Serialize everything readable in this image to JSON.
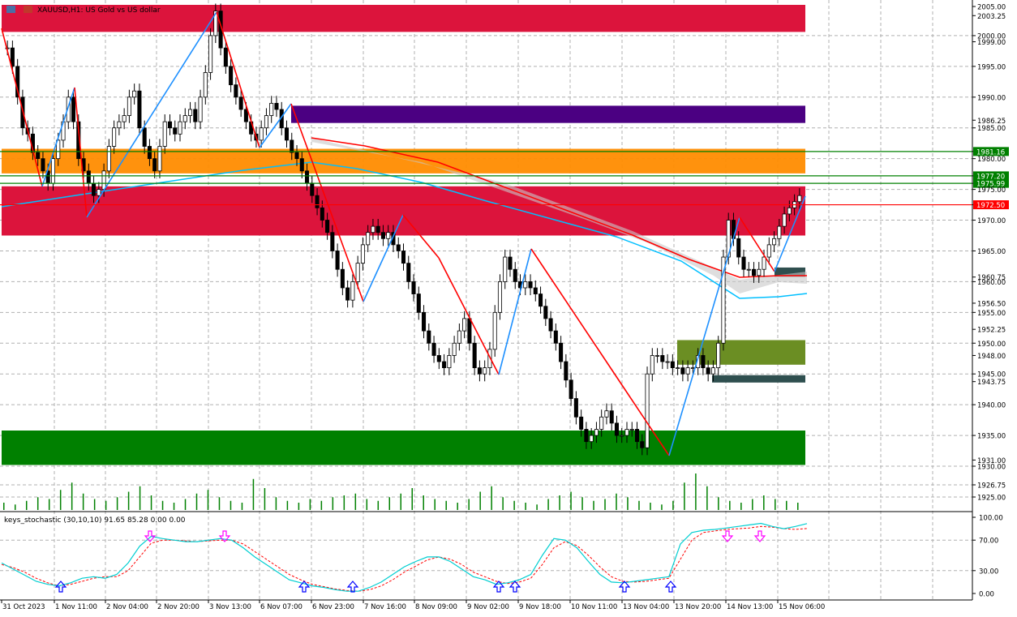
{
  "header": {
    "symbol": "XAUUSD",
    "timeframe": "H1",
    "description": "US Gold vs US dollar",
    "title": "XAUUSD,H1: US Gold vs US dollar"
  },
  "indicator": {
    "label": "keys_stochastic (30,10,10) 91.65 85.28 0.00 0.00",
    "levels": [
      "100.00",
      "70.00",
      "30.00",
      "0.00"
    ]
  },
  "colors": {
    "bull_candle": "#000000",
    "bear_candle": "#000000",
    "supply_zone": "#dc143c",
    "demand_zone": "#008000",
    "purple_zone": "#4b0082",
    "orange_zone": "#ff8c00",
    "olive_zone": "#6b8e23",
    "slate_zone": "#2f4f4f",
    "zigzag_up": "#1e90ff",
    "zigzag_down": "#ff0000",
    "ma_fast": "#00bfff",
    "ma_slow": "#ff0000",
    "stoch_main": "#00ced1",
    "stoch_signal": "#ff0000",
    "volume": "#008000",
    "arrow_up": "#0000ff",
    "arrow_down": "#ff00ff"
  },
  "chart_data": {
    "type": "candlestick",
    "symbol": "XAUUSD",
    "timeframe": "H1",
    "ylim": [
      1925.0,
      2005.0
    ],
    "current_price_label": "1972.50",
    "price_axis_labels": [
      "2005.00",
      "2003.25",
      "2000.00",
      "1999.00",
      "1995.00",
      "1990.00",
      "1986.25",
      "1985.00",
      "1981.16",
      "1980.00",
      "1977.20",
      "1975.99",
      "1975.00",
      "1972.50",
      "1970.00",
      "1965.00",
      "1960.75",
      "1960.00",
      "1956.50",
      "1955.00",
      "1952.25",
      "1950.00",
      "1948.00",
      "1945.00",
      "1943.75",
      "1940.00",
      "1935.00",
      "1931.00",
      "1930.00",
      "1926.75",
      "1925.00"
    ],
    "tagged_levels": [
      {
        "label": "1981.16",
        "value": 1981.16,
        "color": "#008000"
      },
      {
        "label": "1977.20",
        "value": 1977.2,
        "color": "#008000"
      },
      {
        "label": "1975.99",
        "value": 1975.99,
        "color": "#008000"
      },
      {
        "label": "1972.50",
        "value": 1972.5,
        "color": "#ff0000"
      }
    ],
    "zones": [
      {
        "name": "supply-top",
        "from": 2000.6,
        "to": 2005.0,
        "color": "#dc143c"
      },
      {
        "name": "supply-purple",
        "from": 1985.8,
        "to": 1988.6,
        "color": "#4b0082"
      },
      {
        "name": "supply-orange",
        "from": 1977.6,
        "to": 1981.6,
        "color": "#ff8c00"
      },
      {
        "name": "supply-main",
        "from": 1967.5,
        "to": 1975.5,
        "color": "#dc143c"
      },
      {
        "name": "demand-slate-1",
        "from": 1960.8,
        "to": 1962.3,
        "color": "#2f4f4f"
      },
      {
        "name": "demand-olive",
        "from": 1946.5,
        "to": 1950.5,
        "color": "#6b8e23"
      },
      {
        "name": "demand-slate-2",
        "from": 1943.6,
        "to": 1944.8,
        "color": "#2f4f4f"
      },
      {
        "name": "demand-bottom",
        "from": 1930.2,
        "to": 1935.8,
        "color": "#008000"
      }
    ],
    "time_labels": [
      "31 Oct 2023",
      "1 Nov 11:00",
      "2 Nov 04:00",
      "2 Nov 20:00",
      "3 Nov 13:00",
      "6 Nov 07:00",
      "6 Nov 23:00",
      "7 Nov 16:00",
      "8 Nov 09:00",
      "9 Nov 02:00",
      "9 Nov 18:00",
      "10 Nov 11:00",
      "13 Nov 04:00",
      "13 Nov 20:00",
      "14 Nov 13:00",
      "15 Nov 06:00"
    ],
    "close_series": [
      1998,
      1995,
      1990,
      1985,
      1984,
      1981,
      1980,
      1978,
      1976,
      1980,
      1983,
      1986,
      1990,
      1986,
      1980,
      1978,
      1976,
      1974,
      1975,
      1978,
      1982,
      1985,
      1986,
      1987,
      1990,
      1991,
      1985,
      1982,
      1980,
      1978,
      1982,
      1986,
      1985,
      1984,
      1986,
      1987,
      1988,
      1986,
      1990,
      1994,
      2000,
      2004,
      1998,
      1995,
      1992,
      1990,
      1988,
      1986,
      1984,
      1983,
      1985,
      1987,
      1989,
      1988,
      1985,
      1983,
      1981,
      1980,
      1978,
      1976,
      1974,
      1972,
      1970,
      1968,
      1965,
      1962,
      1959,
      1957,
      1960,
      1963,
      1966,
      1968,
      1969,
      1968,
      1967,
      1968,
      1966,
      1965,
      1963,
      1960,
      1958,
      1955,
      1952,
      1950,
      1948,
      1947,
      1946,
      1948,
      1950,
      1952,
      1954,
      1950,
      1946,
      1945,
      1946,
      1949,
      1955,
      1960,
      1964,
      1962,
      1960,
      1959,
      1960,
      1959,
      1958,
      1956,
      1954,
      1952,
      1950,
      1947,
      1944,
      1941,
      1938,
      1936,
      1934,
      1935,
      1936,
      1938,
      1939,
      1937,
      1935,
      1935,
      1936,
      1936,
      1934,
      1933,
      1945,
      1948,
      1948,
      1947,
      1947,
      1946,
      1946,
      1945,
      1946,
      1946,
      1948,
      1946,
      1945,
      1946,
      1950,
      1964,
      1970,
      1967,
      1964,
      1962,
      1962,
      1961,
      1962,
      1964,
      1966,
      1967,
      1969,
      1971,
      1972,
      1973,
      1974
    ],
    "stochastic": {
      "params": "(30,10,10)",
      "main_last": 91.65,
      "signal_last": 85.28,
      "ylim": [
        0,
        100
      ],
      "main_series": [
        40,
        32,
        24,
        16,
        12,
        10,
        14,
        20,
        22,
        20,
        25,
        40,
        62,
        75,
        72,
        70,
        68,
        68,
        70,
        72,
        70,
        60,
        48,
        38,
        28,
        18,
        14,
        10,
        8,
        5,
        3,
        3,
        8,
        15,
        25,
        35,
        42,
        48,
        48,
        42,
        32,
        22,
        18,
        12,
        14,
        18,
        25,
        50,
        72,
        70,
        60,
        42,
        25,
        15,
        14,
        16,
        18,
        20,
        22,
        65,
        80,
        83,
        84,
        86,
        88,
        90,
        92,
        88,
        85,
        88,
        91.65
      ],
      "signal_series": [
        38,
        34,
        28,
        20,
        14,
        10,
        12,
        16,
        20,
        22,
        22,
        30,
        48,
        66,
        70,
        70,
        69,
        68,
        69,
        70,
        70,
        65,
        55,
        45,
        35,
        25,
        18,
        12,
        9,
        6,
        4,
        3,
        5,
        10,
        18,
        28,
        36,
        44,
        48,
        45,
        38,
        28,
        22,
        16,
        13,
        15,
        20,
        38,
        60,
        68,
        63,
        50,
        35,
        22,
        16,
        15,
        16,
        18,
        20,
        45,
        70,
        80,
        82,
        84,
        85,
        86,
        88,
        87,
        85,
        84,
        85.28
      ],
      "arrows_up": [
        "1 Nov",
        "6 Nov",
        "7 Nov",
        "9 Nov",
        "9 Nov",
        "13 Nov",
        "13 Nov"
      ],
      "arrows_down": [
        "2 Nov",
        "3 Nov",
        "14 Nov",
        "15 Nov"
      ]
    },
    "volume_series": [
      8,
      6,
      10,
      14,
      12,
      22,
      30,
      18,
      12,
      10,
      14,
      20,
      26,
      16,
      10,
      8,
      12,
      18,
      22,
      14,
      10,
      8,
      34,
      24,
      14,
      10,
      8,
      12,
      10,
      14,
      16,
      18,
      12,
      10,
      14,
      18,
      24,
      16,
      12,
      10,
      8,
      12,
      20,
      26,
      14,
      10,
      8,
      6,
      12,
      16,
      20,
      14,
      10,
      12,
      18,
      14,
      10,
      8,
      6,
      10,
      30,
      40,
      26,
      14,
      10,
      8,
      12,
      16,
      12,
      10,
      8
    ]
  }
}
